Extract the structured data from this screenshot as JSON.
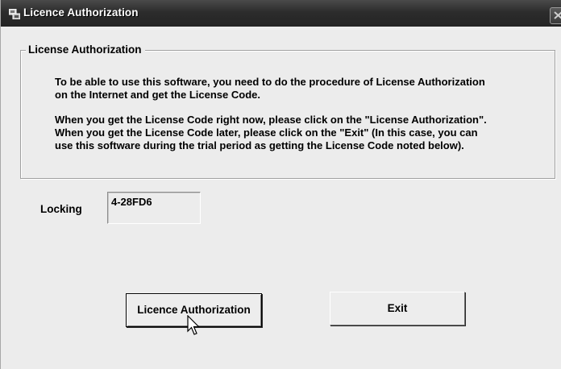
{
  "window": {
    "title": "Licence Authorization"
  },
  "group": {
    "legend": "License Authorization",
    "paragraph1_line1": "To be able to use this software, you need to do the procedure of License Authorization",
    "paragraph1_line2": "on the Internet and get the License Code.",
    "paragraph2_line1": "When you get the License Code right now, please click on the \"License Authorization\".",
    "paragraph2_line2": "When you get the License Code later, please click on the \"Exit\" (In this case, you can",
    "paragraph2_line3": "use this software during the trial period as getting the License Code noted below)."
  },
  "locking": {
    "label": "Locking",
    "value": "4-28FD6"
  },
  "buttons": {
    "authorize_label": "Licence Authorization",
    "exit_label": "Exit"
  },
  "icons": {
    "app": "app-icon",
    "close": "close-icon",
    "cursor": "mouse-pointer-icon"
  }
}
